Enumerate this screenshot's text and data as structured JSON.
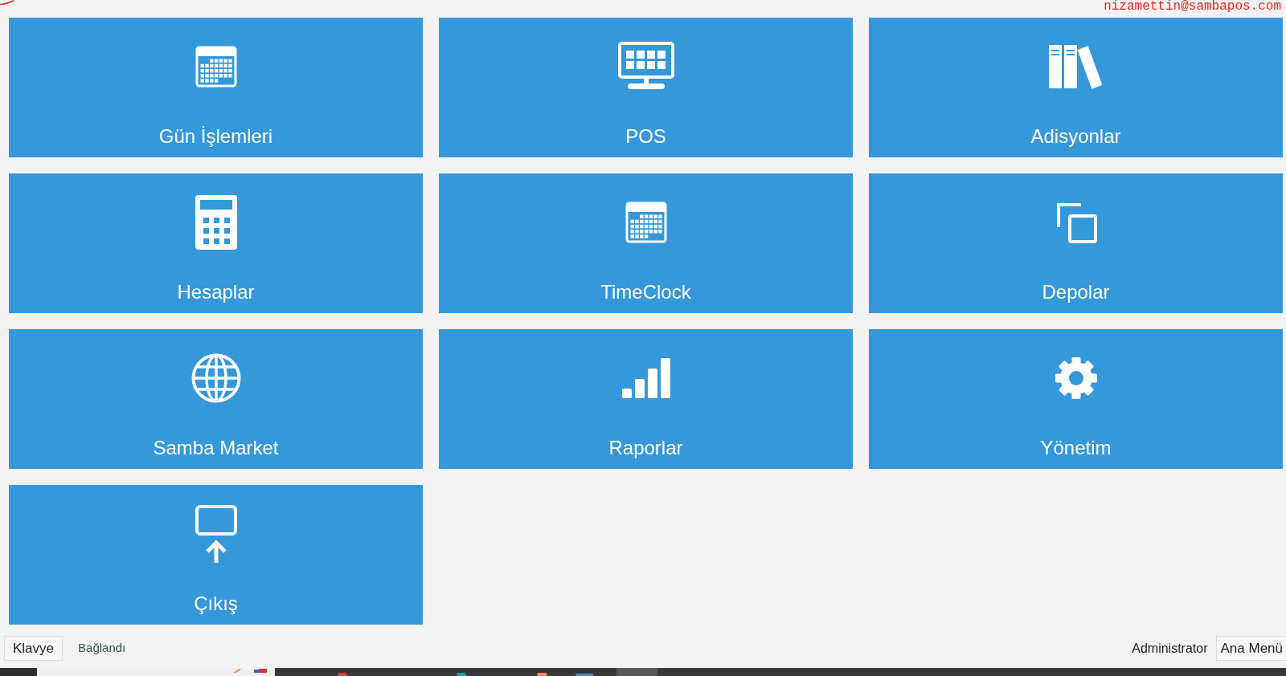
{
  "header": {
    "user_email": "nizamettin@sambapos.com"
  },
  "tiles": [
    {
      "label": "Gün İşlemleri",
      "kind": "calendar"
    },
    {
      "label": "POS",
      "kind": "monitor"
    },
    {
      "label": "Adisyonlar",
      "kind": "books"
    },
    {
      "label": "Hesaplar",
      "kind": "calculator"
    },
    {
      "label": "TimeClock",
      "kind": "calendar"
    },
    {
      "label": "Depolar",
      "kind": "copy"
    },
    {
      "label": "Samba Market",
      "kind": "globe"
    },
    {
      "label": "Raporlar",
      "kind": "chart"
    },
    {
      "label": "Yönetim",
      "kind": "gear"
    },
    {
      "label": "Çıkış",
      "kind": "exit"
    }
  ],
  "status_bar": {
    "keyboard_button": "Klavye",
    "connection_status": "Bağlandı",
    "user": "Administrator",
    "menu_button": "Ana Menü"
  }
}
